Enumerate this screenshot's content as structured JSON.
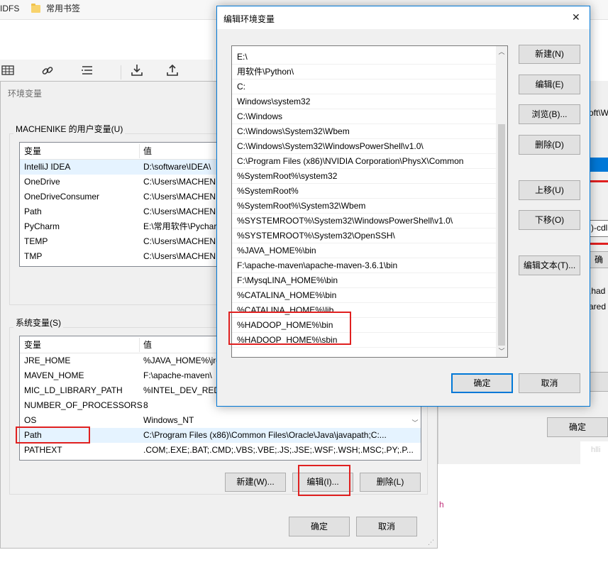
{
  "browser": {
    "bookmark_partial": "IDFS",
    "bookmark_folder": "常用书签"
  },
  "bg_window": {
    "frag_path": "oft\\W",
    "frag_cdl": ")-cdl",
    "frag_ok": "确",
    "frag_had": ",had",
    "frag_ared": "ared",
    "ok": "确定",
    "frag_h": "h",
    "frag_hl": "hlli"
  },
  "env_dialog": {
    "title": "环境变量",
    "user_group": "MACHENIKE 的用户变量(U)",
    "sys_group": "系统变量(S)",
    "col_var": "变量",
    "col_val": "值",
    "user_vars": [
      {
        "name": "IntelliJ IDEA",
        "value": "D:\\software\\IDEA\\",
        "selected": true
      },
      {
        "name": "OneDrive",
        "value": "C:\\Users\\MACHEN"
      },
      {
        "name": "OneDriveConsumer",
        "value": "C:\\Users\\MACHEN"
      },
      {
        "name": "Path",
        "value": "C:\\Users\\MACHEN"
      },
      {
        "name": "PyCharm",
        "value": "E:\\常用软件\\Pychar"
      },
      {
        "name": "TEMP",
        "value": "C:\\Users\\MACHEN"
      },
      {
        "name": "TMP",
        "value": "C:\\Users\\MACHEN"
      }
    ],
    "sys_vars": [
      {
        "name": "JRE_HOME",
        "value": "%JAVA_HOME%\\jre"
      },
      {
        "name": "MAVEN_HOME",
        "value": "F:\\apache-maven\\"
      },
      {
        "name": "MIC_LD_LIBRARY_PATH",
        "value": "%INTEL_DEV_RED"
      },
      {
        "name": "NUMBER_OF_PROCESSORS",
        "value": "8"
      },
      {
        "name": "OS",
        "value": "Windows_NT"
      },
      {
        "name": "Path",
        "value": "C:\\Program Files (x86)\\Common Files\\Oracle\\Java\\javapath;C:...",
        "selected": true
      },
      {
        "name": "PATHEXT",
        "value": ".COM;.EXE;.BAT;.CMD;.VBS;.VBE;.JS;.JSE;.WSF;.WSH;.MSC;.PY;.P..."
      }
    ],
    "btn_new": "新建(W)...",
    "btn_edit": "编辑(I)...",
    "btn_delete": "删除(L)",
    "btn_ok": "确定",
    "btn_cancel": "取消"
  },
  "edit_dialog": {
    "title": "编辑环境变量",
    "paths": [
      "E:\\",
      "用软件\\Python\\",
      "C:",
      "Windows\\system32",
      "C:\\Windows",
      "C:\\Windows\\System32\\Wbem",
      "C:\\Windows\\System32\\WindowsPowerShell\\v1.0\\",
      "C:\\Program Files (x86)\\NVIDIA Corporation\\PhysX\\Common",
      "%SystemRoot%\\system32",
      "%SystemRoot%",
      "%SystemRoot%\\System32\\Wbem",
      "%SYSTEMROOT%\\System32\\WindowsPowerShell\\v1.0\\",
      "%SYSTEMROOT%\\System32\\OpenSSH\\",
      "%JAVA_HOME%\\bin",
      "F:\\apache-maven\\apache-maven-3.6.1\\bin",
      "F:\\MysqLINA_HOME%\\bin",
      "%CATALINA_HOME%\\bin",
      "%CATALINA_HOME%\\lib",
      "%HADOOP_HOME%\\bin",
      "%HADOOP_HOME%\\sbin"
    ],
    "btn_new": "新建(N)",
    "btn_edit": "编辑(E)",
    "btn_browse": "浏览(B)...",
    "btn_delete": "删除(D)",
    "btn_up": "上移(U)",
    "btn_down": "下移(O)",
    "btn_edit_text": "编辑文本(T)...",
    "btn_ok": "确定",
    "btn_cancel": "取消",
    "close_glyph": "✕"
  },
  "colors": {
    "accent": "#0078d7",
    "highlight_box": "#e02020",
    "selected_row": "#e5f3ff",
    "dialog_bg": "#f0f0f0"
  }
}
